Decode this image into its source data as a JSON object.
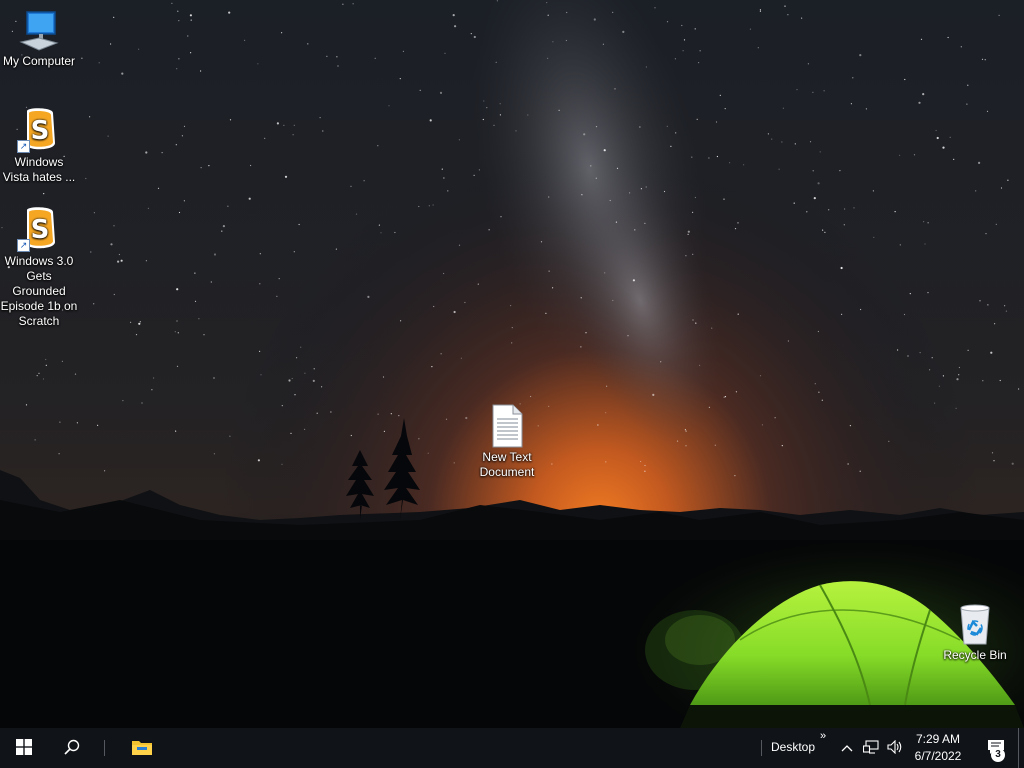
{
  "desktop": {
    "icons": [
      {
        "label": "My Computer",
        "icon": "computer-icon"
      },
      {
        "label": "Windows Vista hates ...",
        "icon": "scratch-icon",
        "shortcut": true
      },
      {
        "label": "Windows 3.0 Gets Grounded Episode 1b on Scratch",
        "icon": "scratch-icon",
        "shortcut": true
      },
      {
        "label": "New Text Document",
        "icon": "text-document-icon"
      },
      {
        "label": "Recycle Bin",
        "icon": "recycle-bin-icon"
      }
    ]
  },
  "taskbar": {
    "start_icon": "windows-logo-icon",
    "search_icon": "search-icon",
    "pinned": [
      {
        "icon": "file-explorer-icon"
      }
    ],
    "toolbar_label": "Desktop",
    "overflow_glyph": "»",
    "tray_icons": [
      "chevron-up-icon",
      "network-icon",
      "volume-icon"
    ],
    "clock": {
      "time": "7:29 AM",
      "date": "6/7/2022"
    },
    "notifications": {
      "icon": "action-center-icon",
      "count": "3"
    }
  },
  "colors": {
    "taskbar_bg": "#101318",
    "scratch_orange": "#F5A623",
    "tent_green": "#8CE02A",
    "horizon_orange": "#E0621A"
  }
}
